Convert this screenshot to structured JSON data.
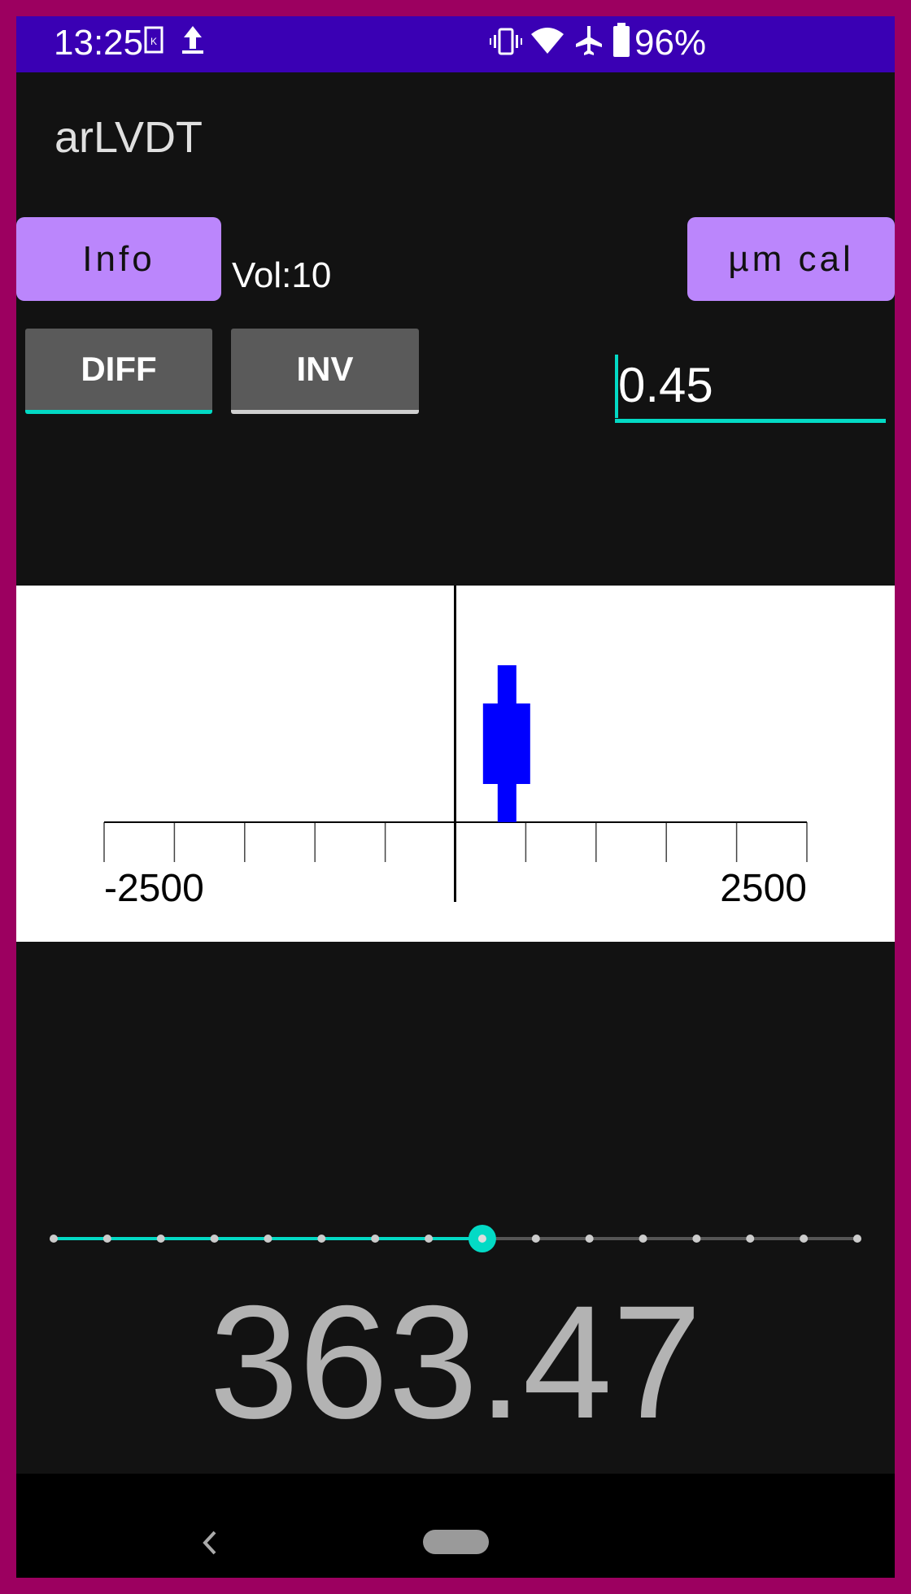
{
  "status_bar": {
    "time": "13:25",
    "battery": "96%",
    "icons": [
      "k-notification-icon",
      "upload-icon",
      "vibrate-icon",
      "wifi-icon",
      "airplane-icon",
      "battery-icon"
    ],
    "bg_color": "#3a00b4"
  },
  "app": {
    "title": "arLVDT"
  },
  "controls": {
    "info_label": "Info",
    "vol_label": "Vol:10",
    "cal_label": "µm cal",
    "diff_label": "DIFF",
    "inv_label": "INV",
    "diff_active": true,
    "inv_active": false,
    "input_value": "0.45"
  },
  "chart_data": {
    "type": "bar",
    "xlim": [
      -2500,
      2500
    ],
    "tick_labels": {
      "min": "-2500",
      "max": "2500"
    },
    "tick_count": 11,
    "marker_value": 363.47,
    "marker_color": "#0000ff"
  },
  "slider": {
    "steps": 16,
    "value_index": 8,
    "accent": "#03dac5"
  },
  "reading": "363.47",
  "colors": {
    "accent": "#03dac5",
    "button": "#bb86fc",
    "frame": "#9c0060"
  }
}
